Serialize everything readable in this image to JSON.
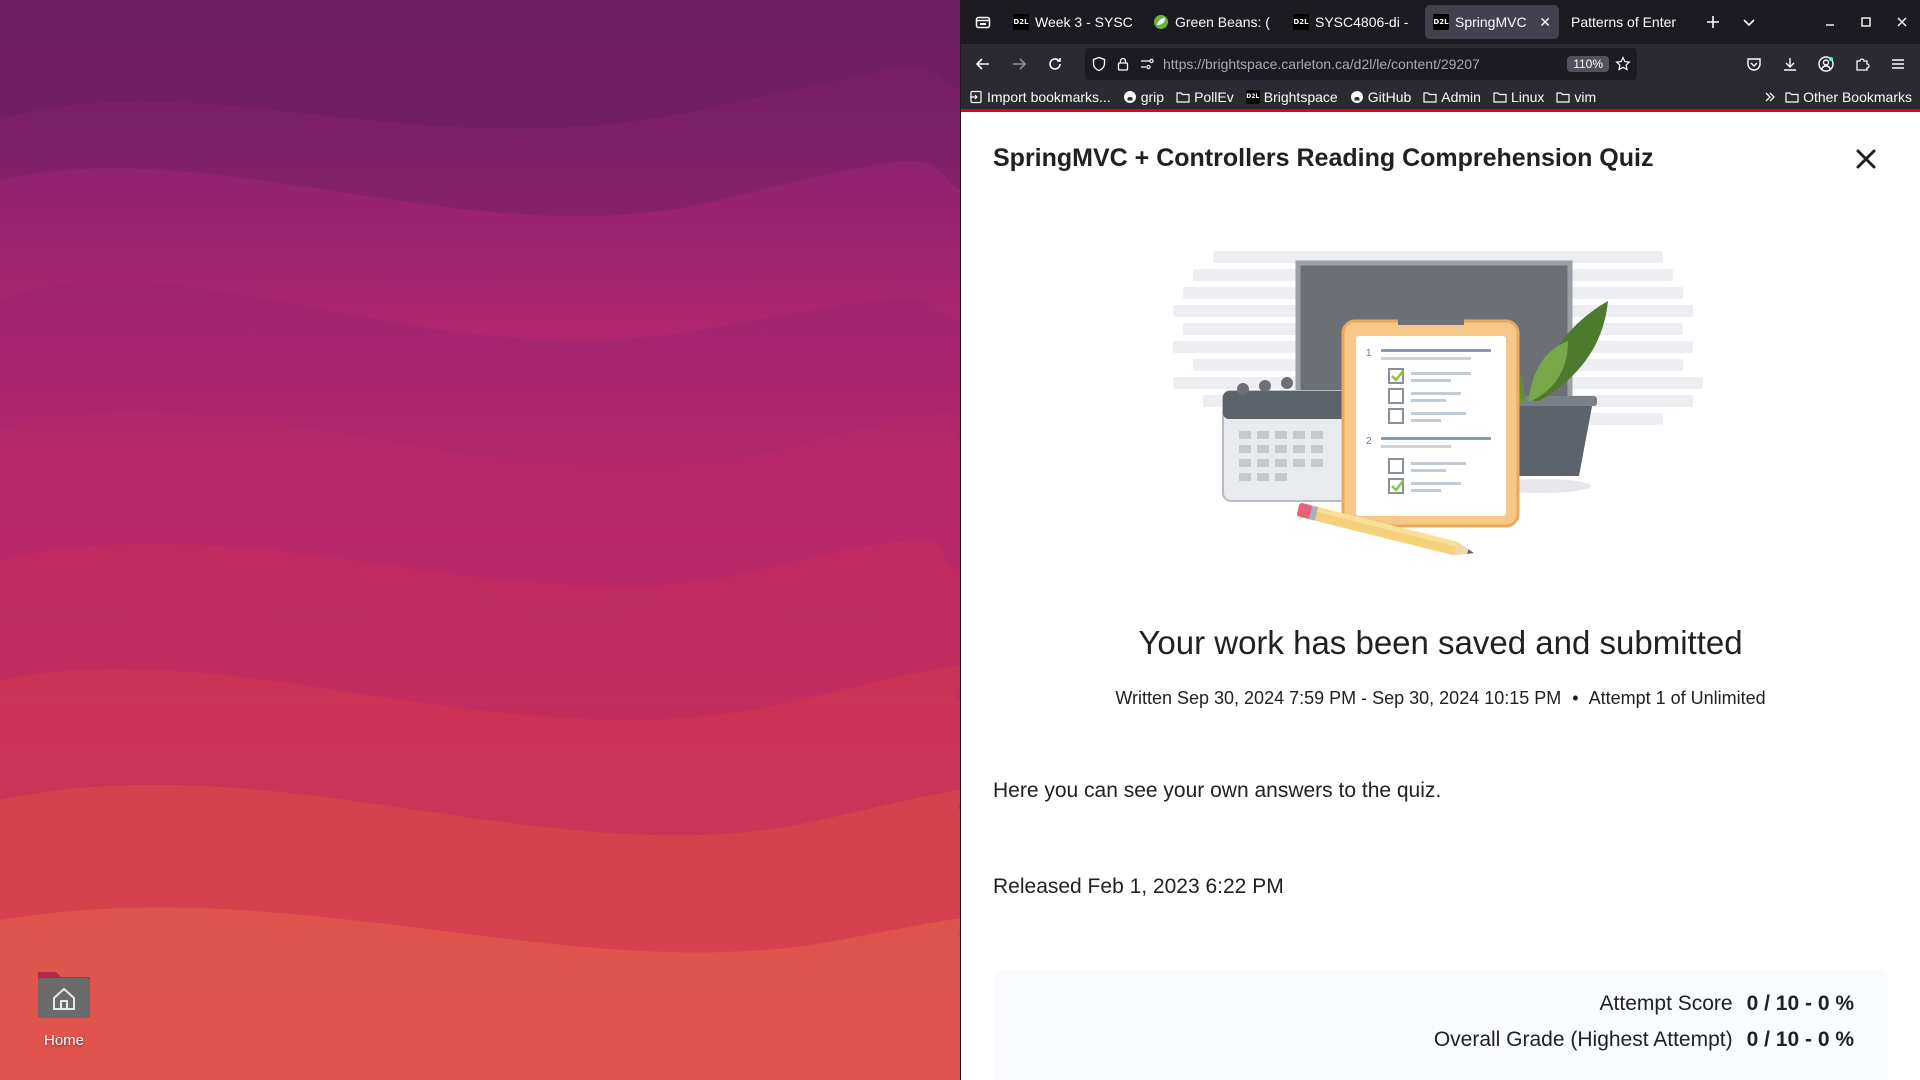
{
  "desktop": {
    "home_label": "Home"
  },
  "browser": {
    "tabs": [
      {
        "title": "Week 3 - SYSC",
        "favicon": "d2l-icon",
        "active": false
      },
      {
        "title": "Green Beans: (",
        "favicon": "spring-leaf-icon",
        "active": false
      },
      {
        "title": "SYSC4806-di -",
        "favicon": "d2l-icon",
        "active": false
      },
      {
        "title": "SpringMVC",
        "favicon": "d2l-icon",
        "active": true
      },
      {
        "title": "Patterns of Enter",
        "favicon": "",
        "active": false
      }
    ],
    "url_host": "https://brightspace.carleton.ca",
    "url_path": "/d2l/le/content/29207",
    "zoom": "110%",
    "bookmarks": [
      {
        "label": "Import bookmarks...",
        "icon": "import-icon"
      },
      {
        "label": "grip",
        "icon": "github-icon"
      },
      {
        "label": "PollEv",
        "icon": "folder-icon"
      },
      {
        "label": "Brightspace",
        "icon": "d2l-icon"
      },
      {
        "label": "GitHub",
        "icon": "github-icon"
      },
      {
        "label": "Admin",
        "icon": "folder-icon"
      },
      {
        "label": "Linux",
        "icon": "folder-icon"
      },
      {
        "label": "vim",
        "icon": "folder-icon"
      }
    ],
    "other_bookmarks": "Other Bookmarks"
  },
  "quiz": {
    "title": "SpringMVC + Controllers Reading Comprehension Quiz",
    "status_heading": "Your work has been saved and submitted",
    "written_range": "Written Sep 30, 2024 7:59 PM - Sep 30, 2024 10:15 PM",
    "bullet": "•",
    "attempt": "Attempt 1 of Unlimited",
    "own_answers_text": "Here you can see your own answers to the quiz.",
    "released": "Released Feb 1, 2023 6:22 PM",
    "attempt_score_label": "Attempt Score",
    "attempt_score_value": "0 / 10 - 0 %",
    "overall_grade_label": "Overall Grade (Highest Attempt)",
    "overall_grade_value": "0 / 10 - 0 %"
  },
  "colors": {
    "accent_red": "#e2001a",
    "tabbar_bg": "#1c1b22",
    "toolbar_bg": "#2b2a33"
  }
}
